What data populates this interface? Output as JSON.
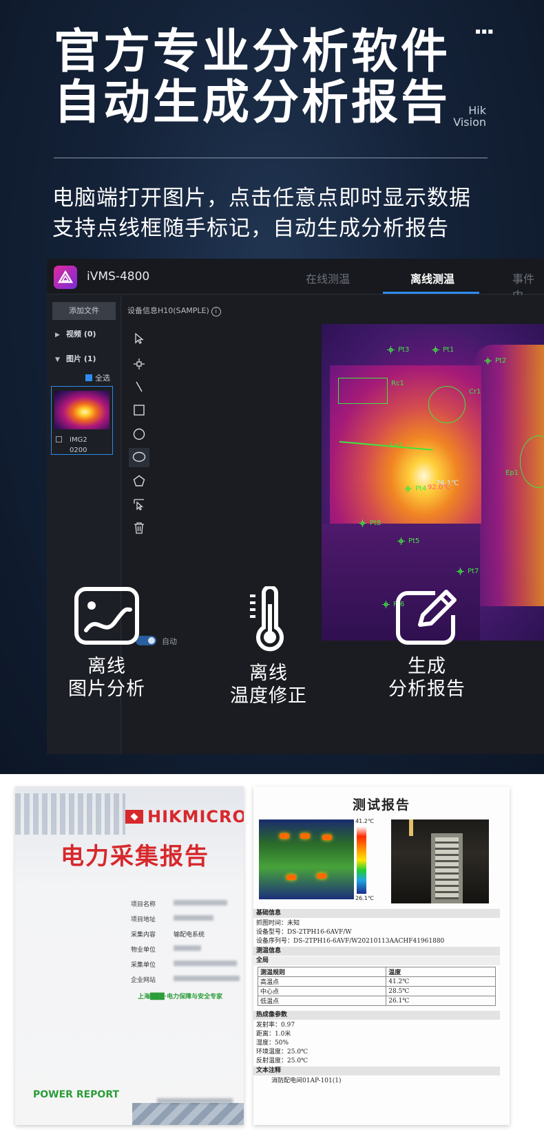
{
  "hero": {
    "headline_1": "官方专业分析软件",
    "headline_2": "自动生成分析报告",
    "brand_dots": "▪▪▪",
    "brand_line1": "Hik",
    "brand_line2": "Vision",
    "subline_1": "电脑端打开图片，点击任意点即时显示数据",
    "subline_2": "支持点线框随手标记，自动生成分析报告"
  },
  "app": {
    "name": "iVMS-4800",
    "tabs": [
      "在线测温",
      "离线测温",
      "事件中"
    ],
    "active_tab": "离线测温",
    "sidebar": {
      "add_file": "添加文件",
      "video": "视频 (0)",
      "images": "图片 (1)",
      "select_all": "全选",
      "thumb_name_1": "IMG2",
      "thumb_name_2": "0200"
    },
    "device_info": "设备信息H10(SAMPLE)",
    "auto_label": "自动",
    "markers": {
      "pt1": "Pt1",
      "pt2": "Pt2",
      "pt3": "Pt3",
      "pt4": "Pt4",
      "pt5": "Pt5",
      "pt6": "Pt6",
      "pt7": "Pt7",
      "pt8": "Pt8",
      "rc1": "Rc1",
      "cr1": "Cr1",
      "ln1": "Ln1",
      "ep1": "Ep1",
      "center_temp": "76.1℃",
      "max_temp": "92.0℃"
    }
  },
  "features": [
    {
      "icon": "chart-image-icon",
      "line1": "离线",
      "line2": "图片分析"
    },
    {
      "icon": "thermometer-icon",
      "line1": "离线",
      "line2": "温度修正"
    },
    {
      "icon": "edit-icon",
      "line1": "生成",
      "line2": "分析报告"
    }
  ],
  "cover": {
    "brand": "HIKMICRO",
    "title": "电力采集报告",
    "rows": [
      {
        "label": "项目名称"
      },
      {
        "label": "项目地址"
      },
      {
        "label": "采集内容",
        "value": "输配电系统"
      },
      {
        "label": "物业单位"
      },
      {
        "label": "采集单位"
      },
      {
        "label": "企业网站"
      }
    ],
    "slogan": "上海███·电力保障与安全专家",
    "power_report": "POWER REPORT"
  },
  "test_report": {
    "title": "测试报告",
    "scale_max": "41.2℃",
    "scale_min": "26.1℃",
    "basic_info": "基础信息",
    "capture_time": "抓图时间：未知",
    "model": "设备型号：DS-2TPH16-6AVF/W",
    "serial": "设备序列号：DS-2TPH16-6AVF/W20210113AACHF41961880",
    "measure_info": "测温信息",
    "global": "全局",
    "table": {
      "headers": [
        "测温规则",
        "温度"
      ],
      "rows": [
        [
          "高温点",
          "41.2℃"
        ],
        [
          "中心点",
          "28.5℃"
        ],
        [
          "低温点",
          "26.1℃"
        ]
      ]
    },
    "params_head": "热成像参数",
    "emissivity": "发射率：0.97",
    "distance": "距离：1.0米",
    "humidity": "湿度：50%",
    "ambient": "环境温度：25.0℃",
    "reflected": "反射温度：25.0℃",
    "notes_head": "文本注释",
    "note": "消防配电间01AP-101(1)"
  },
  "colors": {
    "accent": "#2e8cf0",
    "marker": "#3ee63e",
    "brand_red": "#d7282c",
    "report_green": "#2c9d3a"
  }
}
